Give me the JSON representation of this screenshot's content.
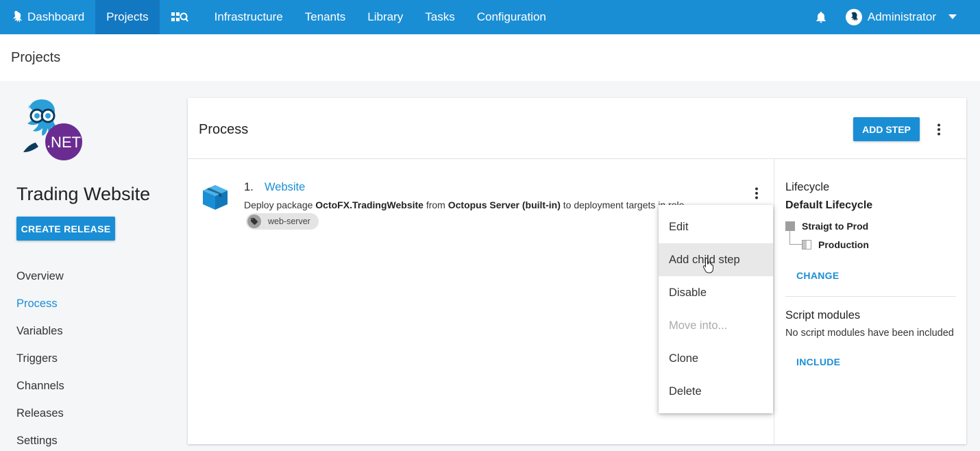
{
  "nav": {
    "items": [
      {
        "label": "Dashboard",
        "icon": "octopus-icon",
        "active": false
      },
      {
        "label": "Projects",
        "active": true
      },
      {
        "label": "",
        "icon": "search-dashboard-icon",
        "active": false
      },
      {
        "label": "Infrastructure",
        "active": false
      },
      {
        "label": "Tenants",
        "active": false
      },
      {
        "label": "Library",
        "active": false
      },
      {
        "label": "Tasks",
        "active": false
      },
      {
        "label": "Configuration",
        "active": false
      }
    ],
    "user": "Administrator",
    "accent": "#1a8ed5"
  },
  "page": {
    "title": "Projects"
  },
  "sidebar": {
    "logo_text": ".NET",
    "project_name": "Trading Website",
    "create_release": "CREATE RELEASE",
    "items": [
      {
        "label": "Overview",
        "active": false
      },
      {
        "label": "Process",
        "active": true
      },
      {
        "label": "Variables",
        "active": false
      },
      {
        "label": "Triggers",
        "active": false
      },
      {
        "label": "Channels",
        "active": false
      },
      {
        "label": "Releases",
        "active": false
      },
      {
        "label": "Settings",
        "active": false
      }
    ]
  },
  "process": {
    "title": "Process",
    "add_step": "ADD STEP",
    "step": {
      "number": "1.",
      "name": "Website",
      "desc_prefix": "Deploy package ",
      "package": "OctoFX.TradingWebsite",
      "desc_mid": " from ",
      "feed": "Octopus Server (built-in)",
      "desc_suffix": " to deployment targets in role",
      "role": "web-server"
    }
  },
  "lifecycle": {
    "heading": "Lifecycle",
    "name": "Default Lifecycle",
    "phase": "Straigt to Prod",
    "environment": "Production",
    "change": "CHANGE"
  },
  "script_modules": {
    "heading": "Script modules",
    "text": "No script modules have been included",
    "include": "INCLUDE"
  },
  "menu": {
    "items": [
      {
        "label": "Edit",
        "state": "normal"
      },
      {
        "label": "Add child step",
        "state": "hover"
      },
      {
        "label": "Disable",
        "state": "normal"
      },
      {
        "label": "Move into...",
        "state": "disabled"
      },
      {
        "label": "Clone",
        "state": "normal"
      },
      {
        "label": "Delete",
        "state": "normal"
      }
    ]
  }
}
